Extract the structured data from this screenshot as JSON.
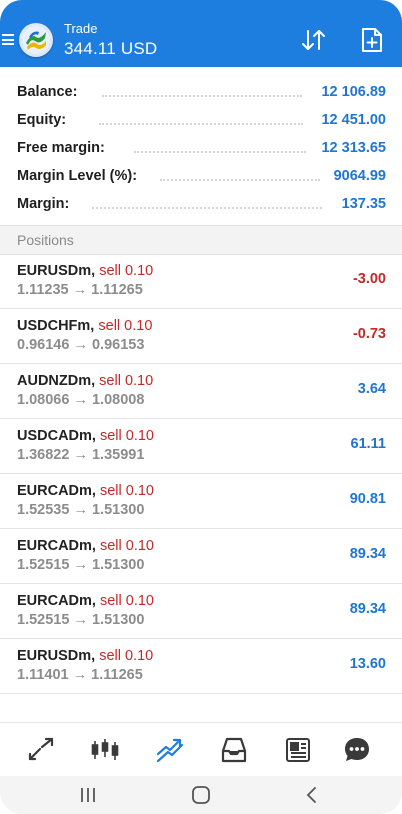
{
  "header": {
    "title": "Trade",
    "subtitle": "344.11 USD",
    "accent_color": "#1e7ee0",
    "icons": [
      "menu-icon",
      "metatrader-logo",
      "sort-icon",
      "new-order-icon"
    ]
  },
  "summary": [
    {
      "label": "Balance:",
      "value": "12 106.89"
    },
    {
      "label": "Equity:",
      "value": "12 451.00"
    },
    {
      "label": "Free margin:",
      "value": "12 313.65"
    },
    {
      "label": "Margin Level (%):",
      "value": "9064.99"
    },
    {
      "label": "Margin:",
      "value": "137.35"
    }
  ],
  "positions_header": "Positions",
  "positions": [
    {
      "symbol": "EURUSDm,",
      "side": "sell 0.10",
      "prices": "1.11235 → 1.11265",
      "profit": "-3.00",
      "profit_color": "#c62828"
    },
    {
      "symbol": "USDCHFm,",
      "side": "sell 0.10",
      "prices": "0.96146 → 0.96153",
      "profit": "-0.73",
      "profit_color": "#c62828"
    },
    {
      "symbol": "AUDNZDm,",
      "side": "sell 0.10",
      "prices": "1.08066 → 1.08008",
      "profit": "3.64",
      "profit_color": "#1f76d2"
    },
    {
      "symbol": "USDCADm,",
      "side": "sell 0.10",
      "prices": "1.36822 → 1.35991",
      "profit": "61.11",
      "profit_color": "#1f76d2"
    },
    {
      "symbol": "EURCADm,",
      "side": "sell 0.10",
      "prices": "1.52535 → 1.51300",
      "profit": "90.81",
      "profit_color": "#1f76d2"
    },
    {
      "symbol": "EURCADm,",
      "side": "sell 0.10",
      "prices": "1.52515 → 1.51300",
      "profit": "89.34",
      "profit_color": "#1f76d2"
    },
    {
      "symbol": "EURCADm,",
      "side": "sell 0.10",
      "prices": "1.52515 → 1.51300",
      "profit": "89.34",
      "profit_color": "#1f76d2"
    },
    {
      "symbol": "EURUSDm,",
      "side": "sell 0.10",
      "prices": "1.11401 → 1.11265",
      "profit": "13.60",
      "profit_color": "#1f76d2"
    }
  ],
  "toolbar_icons": [
    "quotes-icon",
    "chart-icon",
    "trade-icon",
    "history-icon",
    "news-icon",
    "chat-icon"
  ],
  "navbar_icons": [
    "recents-icon",
    "home-icon",
    "back-icon"
  ]
}
